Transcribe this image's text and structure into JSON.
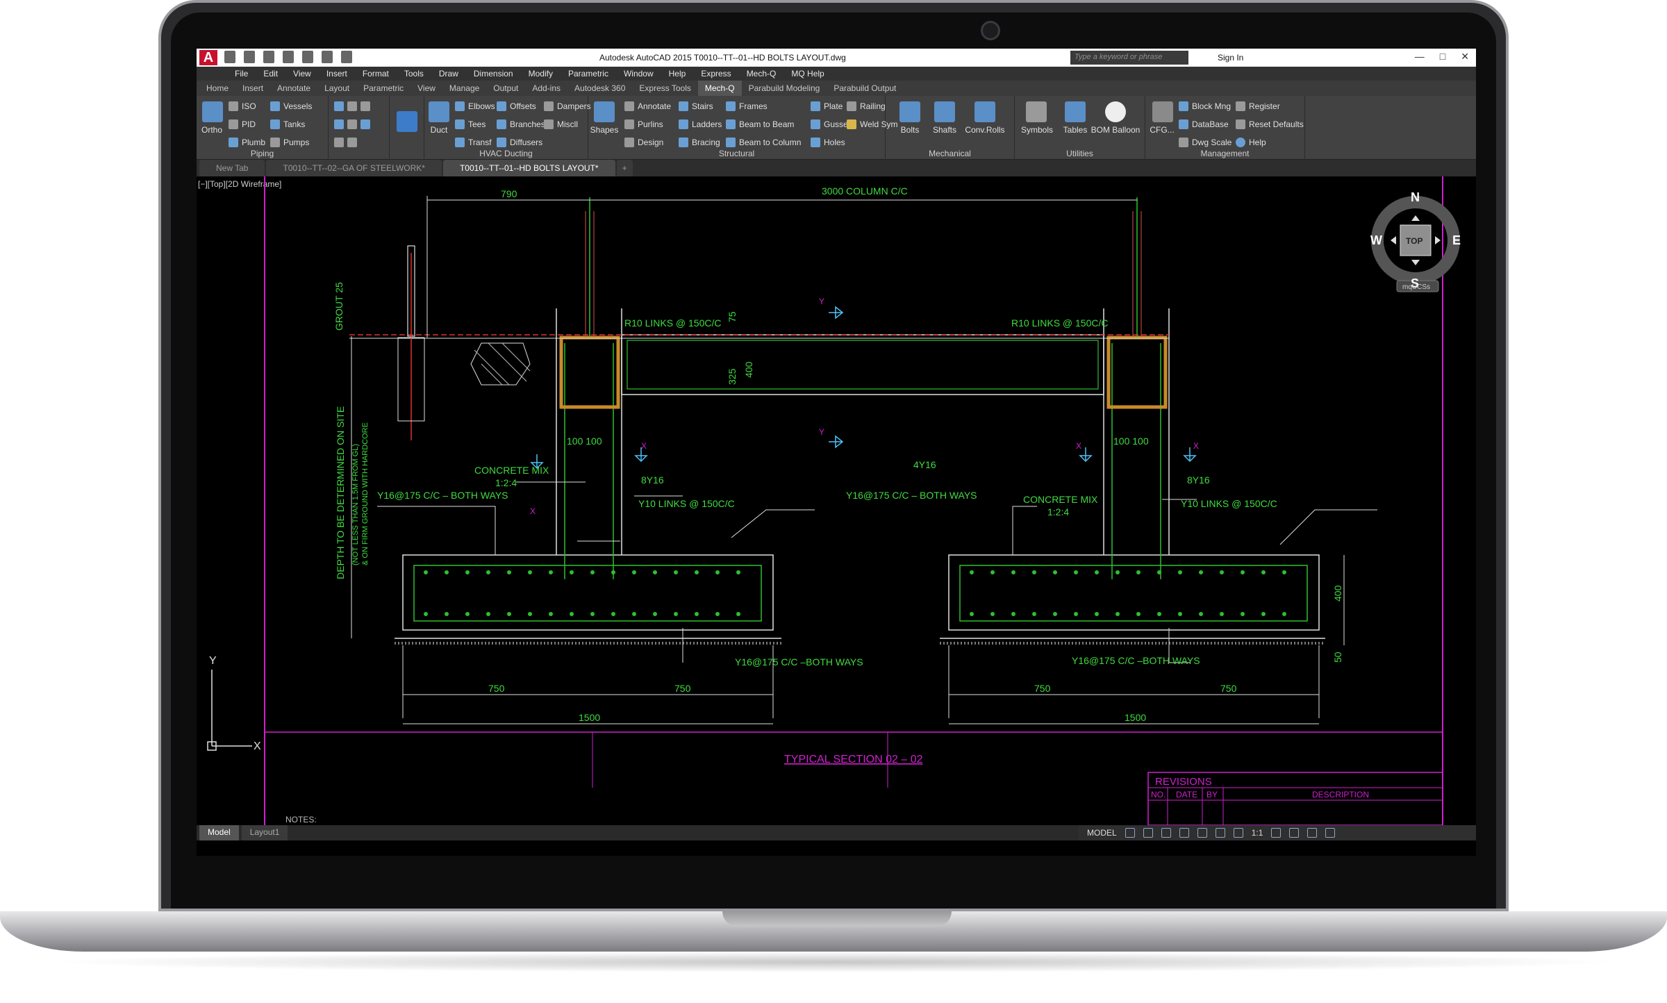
{
  "window": {
    "app_logo": "A",
    "title": "Autodesk AutoCAD 2015   T0010--TT--01--HD BOLTS LAYOUT.dwg",
    "search_placeholder": "Type a keyword or phrase",
    "sign_in": "Sign In"
  },
  "menu": [
    "File",
    "Edit",
    "View",
    "Insert",
    "Format",
    "Tools",
    "Draw",
    "Dimension",
    "Modify",
    "Parametric",
    "Window",
    "Help",
    "Express",
    "Mech-Q",
    "MQ Help"
  ],
  "ribbon_tabs": [
    {
      "label": "Home",
      "active": false
    },
    {
      "label": "Insert",
      "active": false
    },
    {
      "label": "Annotate",
      "active": false
    },
    {
      "label": "Layout",
      "active": false
    },
    {
      "label": "Parametric",
      "active": false
    },
    {
      "label": "View",
      "active": false
    },
    {
      "label": "Manage",
      "active": false
    },
    {
      "label": "Output",
      "active": false
    },
    {
      "label": "Add-ins",
      "active": false
    },
    {
      "label": "Autodesk 360",
      "active": false
    },
    {
      "label": "Express Tools",
      "active": false
    },
    {
      "label": "Mech-Q",
      "active": true
    },
    {
      "label": "Parabuild Modeling",
      "active": false
    },
    {
      "label": "Parabuild Output",
      "active": false
    }
  ],
  "ribbon": {
    "piping": {
      "title": "Piping",
      "ortho": "Ortho",
      "iso": "ISO",
      "pid": "PID",
      "plumb": "Plumb",
      "vessels": "Vessels",
      "tanks": "Tanks",
      "pumps": "Pumps"
    },
    "hvac": {
      "title": "HVAC Ducting",
      "duct": "Duct",
      "elbows": "Elbows",
      "tees": "Tees",
      "transf": "Transf",
      "offsets": "Offsets",
      "branches": "Branches",
      "diffusers": "Diffusers",
      "dampers": "Dampers",
      "miscll": "Miscll"
    },
    "structural": {
      "title": "Structural",
      "shapes": "Shapes",
      "annotate": "Annotate",
      "purlins": "Purlins",
      "design": "Design",
      "stairs": "Stairs",
      "ladders": "Ladders",
      "bracing": "Bracing",
      "frames": "Frames",
      "beam_to_beam": "Beam to Beam",
      "beam_to_column": "Beam to Column",
      "plate": "Plate",
      "gusset": "Gusset",
      "holes": "Holes",
      "railing": "Railing",
      "weld_sym": "Weld Sym"
    },
    "mechanical": {
      "title": "Mechanical",
      "bolts": "Bolts",
      "shafts": "Shafts",
      "conv_rolls": "Conv.Rolls"
    },
    "utilities": {
      "title": "Utilities",
      "symbols": "Symbols",
      "tables": "Tables",
      "bom_balloon": "BOM Balloon"
    },
    "management": {
      "title": "Management",
      "cfg": "CFG...",
      "block_mng": "Block Mng",
      "database": "DataBase",
      "dwg_scale": "Dwg Scale",
      "register": "Register",
      "reset_defaults": "Reset Defaults",
      "help": "Help"
    }
  },
  "file_tabs": [
    {
      "label": "New Tab",
      "active": false
    },
    {
      "label": "T0010--TT--02--GA OF STEELWORK*",
      "active": false
    },
    {
      "label": "T0010--TT--01--HD BOLTS LAYOUT*",
      "active": true
    }
  ],
  "viewport_label": "[−][Top][2D Wireframe]",
  "viewcube": {
    "n": "N",
    "s": "S",
    "e": "E",
    "w": "W",
    "top": "TOP",
    "ucs": "mqUCSs"
  },
  "ucs": {
    "x": "X",
    "y": "Y"
  },
  "drawing": {
    "dim_790": "790",
    "dim_3000": "3000  COLUMN  C/C",
    "grout": "GROUT  25",
    "r10_left": "R10  LINKS  @  150C/C",
    "r10_right": "R10  LINKS  @  150C/C",
    "dim_75": "75",
    "dim_325": "325",
    "dim_400a": "400",
    "dim_100_100_left": "100  100",
    "dim_100_100_right": "100  100",
    "rebar_4y16": "4Y16",
    "rebar_8y16_left": "8Y16",
    "rebar_8y16_right": "8Y16",
    "concrete_left": "CONCRETE  MIX",
    "concrete_ratio_left": "1:2:4",
    "concrete_right": "CONCRETE  MIX",
    "concrete_ratio_right": "1:2:4",
    "y16_both_left": "Y16@175  C/C  –  BOTH  WAYS",
    "y16_both_right": "Y16@175  C/C  –  BOTH  WAYS",
    "y10_left": "Y10  LINKS  @  150C/C",
    "y10_right": "Y10  LINKS  @  150C/C",
    "depth_note": "DEPTH  TO  BE  DETERMINED  ON  SITE",
    "depth_note2": "(NOT  LESS  THAN  1.5M  FROM  GL)",
    "depth_note3": "&  ON  FIRM  GROUND  WITH  HARDCORE",
    "y16_bottom_left": "Y16@175  C/C  –BOTH  WAYS",
    "y16_bottom_right": "Y16@175  C/C  –BOTH  WAYS",
    "dim_750_1": "750",
    "dim_750_2": "750",
    "dim_750_3": "750",
    "dim_750_4": "750",
    "dim_1500_left": "1500",
    "dim_1500_right": "1500",
    "dim_400b": "400",
    "dim_50": "50",
    "section_title": "TYPICAL  SECTION  02 – 02",
    "notes": "NOTES:",
    "x_mark": "X",
    "y_mark": "Y"
  },
  "revisions": {
    "title": "REVISIONS",
    "no": "NO.",
    "date": "DATE",
    "by": "BY",
    "description": "DESCRIPTION"
  },
  "layout_tabs": [
    {
      "label": "Model",
      "active": true
    },
    {
      "label": "Layout1",
      "active": false
    }
  ],
  "status": {
    "model": "MODEL",
    "scale": "1:1"
  }
}
